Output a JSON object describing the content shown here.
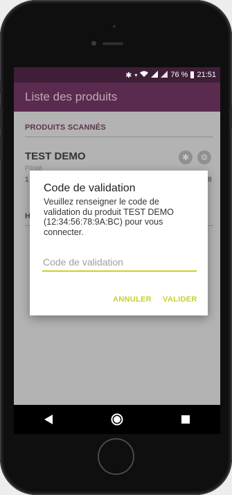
{
  "status_bar": {
    "battery": "76 %",
    "time": "21:51"
  },
  "app_bar": {
    "title": "Liste des produits"
  },
  "sections": {
    "scanned_header": "PRODUITS SCANNÉS",
    "history_header_partial": "H"
  },
  "product": {
    "name": "TEST DEMO",
    "subtitle": "Piloté",
    "id_start": "1",
    "id_end": "8"
  },
  "dialog": {
    "title": "Code de validation",
    "message": "Veuillez renseigner le code de validation du produit TEST DEMO (12:34:56:78:9A:BC) pour vous connecter.",
    "input_placeholder": "Code de validation",
    "input_value": "",
    "cancel_label": "ANNULER",
    "confirm_label": "VALIDER"
  },
  "colors": {
    "accent": "#c8d22a",
    "primary": "#5a2b4e",
    "primary_dark": "#3f1e37"
  }
}
